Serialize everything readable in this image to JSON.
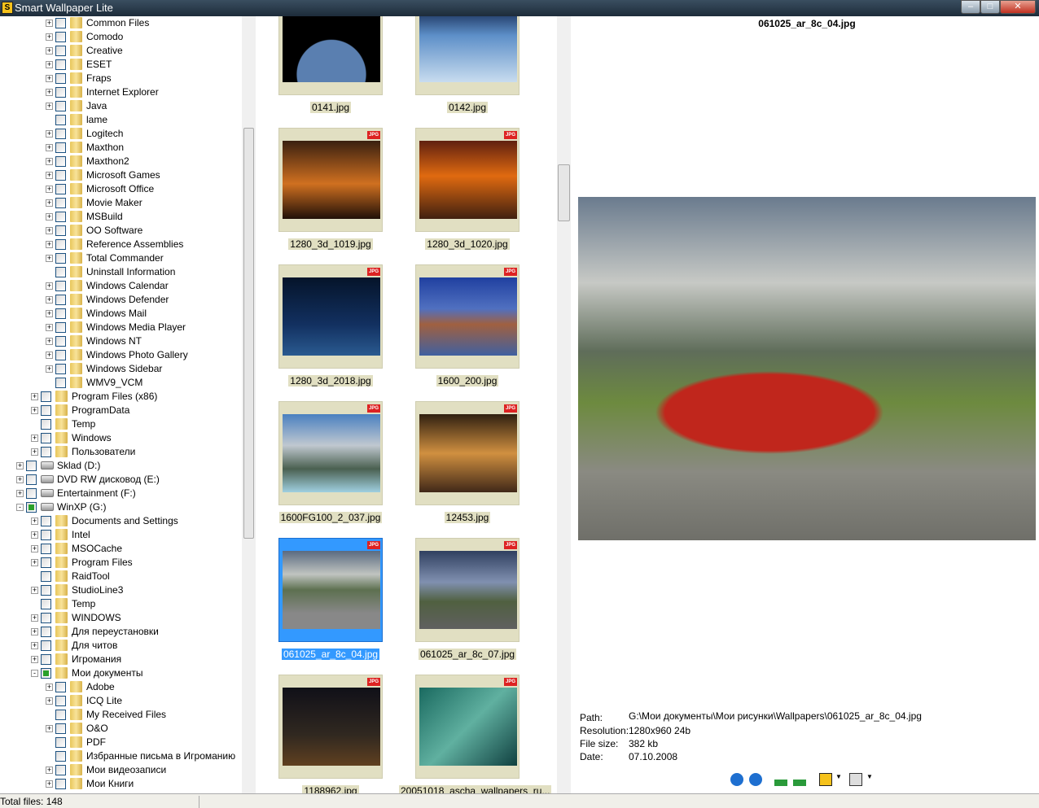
{
  "window": {
    "title": "Smart Wallpaper Lite",
    "minimize": "–",
    "maximize": "□",
    "close": "✕"
  },
  "tree": [
    {
      "l": 3,
      "e": "+",
      "t": "Common Files"
    },
    {
      "l": 3,
      "e": "+",
      "t": "Comodo"
    },
    {
      "l": 3,
      "e": "+",
      "t": "Creative"
    },
    {
      "l": 3,
      "e": "+",
      "t": "ESET"
    },
    {
      "l": 3,
      "e": "+",
      "t": "Fraps"
    },
    {
      "l": 3,
      "e": "+",
      "t": "Internet Explorer"
    },
    {
      "l": 3,
      "e": "+",
      "t": "Java"
    },
    {
      "l": 3,
      "e": "",
      "t": "lame"
    },
    {
      "l": 3,
      "e": "+",
      "t": "Logitech"
    },
    {
      "l": 3,
      "e": "+",
      "t": "Maxthon"
    },
    {
      "l": 3,
      "e": "+",
      "t": "Maxthon2"
    },
    {
      "l": 3,
      "e": "+",
      "t": "Microsoft Games"
    },
    {
      "l": 3,
      "e": "+",
      "t": "Microsoft Office"
    },
    {
      "l": 3,
      "e": "+",
      "t": "Movie Maker"
    },
    {
      "l": 3,
      "e": "+",
      "t": "MSBuild"
    },
    {
      "l": 3,
      "e": "+",
      "t": "OO Software"
    },
    {
      "l": 3,
      "e": "+",
      "t": "Reference Assemblies"
    },
    {
      "l": 3,
      "e": "+",
      "t": "Total Commander"
    },
    {
      "l": 3,
      "e": "",
      "t": "Uninstall Information"
    },
    {
      "l": 3,
      "e": "+",
      "t": "Windows Calendar"
    },
    {
      "l": 3,
      "e": "+",
      "t": "Windows Defender"
    },
    {
      "l": 3,
      "e": "+",
      "t": "Windows Mail"
    },
    {
      "l": 3,
      "e": "+",
      "t": "Windows Media Player"
    },
    {
      "l": 3,
      "e": "+",
      "t": "Windows NT"
    },
    {
      "l": 3,
      "e": "+",
      "t": "Windows Photo Gallery"
    },
    {
      "l": 3,
      "e": "+",
      "t": "Windows Sidebar"
    },
    {
      "l": 3,
      "e": "",
      "t": "WMV9_VCM"
    },
    {
      "l": 2,
      "e": "+",
      "t": "Program Files (x86)"
    },
    {
      "l": 2,
      "e": "+",
      "t": "ProgramData"
    },
    {
      "l": 2,
      "e": "",
      "t": "Temp"
    },
    {
      "l": 2,
      "e": "+",
      "t": "Windows"
    },
    {
      "l": 2,
      "e": "+",
      "t": "Пользователи"
    },
    {
      "l": 1,
      "e": "+",
      "t": "Sklad (D:)",
      "drive": true
    },
    {
      "l": 1,
      "e": "+",
      "t": "DVD RW дисковод (E:)",
      "drive": true
    },
    {
      "l": 1,
      "e": "+",
      "t": "Entertainment (F:)",
      "drive": true
    },
    {
      "l": 1,
      "e": "-",
      "t": "WinXP (G:)",
      "drive": true,
      "checked": true
    },
    {
      "l": 2,
      "e": "+",
      "t": "Documents and Settings"
    },
    {
      "l": 2,
      "e": "+",
      "t": "Intel"
    },
    {
      "l": 2,
      "e": "+",
      "t": "MSOCache"
    },
    {
      "l": 2,
      "e": "+",
      "t": "Program Files"
    },
    {
      "l": 2,
      "e": "",
      "t": "RaidTool"
    },
    {
      "l": 2,
      "e": "+",
      "t": "StudioLine3"
    },
    {
      "l": 2,
      "e": "",
      "t": "Temp"
    },
    {
      "l": 2,
      "e": "+",
      "t": "WINDOWS"
    },
    {
      "l": 2,
      "e": "+",
      "t": "Для переустановки"
    },
    {
      "l": 2,
      "e": "+",
      "t": "Для читов"
    },
    {
      "l": 2,
      "e": "+",
      "t": "Игромания"
    },
    {
      "l": 2,
      "e": "-",
      "t": "Мои документы",
      "checked": true
    },
    {
      "l": 3,
      "e": "+",
      "t": "Adobe"
    },
    {
      "l": 3,
      "e": "+",
      "t": "ICQ Lite"
    },
    {
      "l": 3,
      "e": "",
      "t": "My Received Files"
    },
    {
      "l": 3,
      "e": "+",
      "t": "O&O"
    },
    {
      "l": 3,
      "e": "",
      "t": "PDF"
    },
    {
      "l": 3,
      "e": "",
      "t": "Избранные письма в Игроманию"
    },
    {
      "l": 3,
      "e": "+",
      "t": "Мои видеозаписи"
    },
    {
      "l": 3,
      "e": "+",
      "t": "Мои Книги"
    }
  ],
  "thumbnails": [
    {
      "name": "0141.jpg",
      "badge": "",
      "bg": "radial-gradient(circle at 50% 90%,#5a7fb0 0 40%,#000 41%)"
    },
    {
      "name": "0142.jpg",
      "badge": "",
      "bg": "linear-gradient(#0a1a40,#5d8fc8 40%,#c8dcef)"
    },
    {
      "name": "1280_3d_1019.jpg",
      "badge": "JPG",
      "bg": "linear-gradient(#3a2010,#d07020 55%,#201008)"
    },
    {
      "name": "1280_3d_1020.jpg",
      "badge": "JPG",
      "bg": "linear-gradient(#602010,#e06a10 45%,#402010)"
    },
    {
      "name": "1280_3d_2018.jpg",
      "badge": "JPG",
      "bg": "linear-gradient(#05142a,#123060 60%,#2a5a90)"
    },
    {
      "name": "1600_200.jpg",
      "badge": "JPG",
      "bg": "linear-gradient(#2040a0,#5070c0 40%,#a06040 60%,#4060a0)"
    },
    {
      "name": "1600FG100_2_037.jpg",
      "badge": "JPG",
      "bg": "linear-gradient(#4a80c0,#c0c8d0 40%,#4a6050 70%,#a0d0e0)"
    },
    {
      "name": "12453.jpg",
      "badge": "JPG",
      "bg": "linear-gradient(#302010,#d09040 50%,#402818)"
    },
    {
      "name": "061025_ar_8c_04.jpg",
      "badge": "JPG",
      "bg": "linear-gradient(#5a6a80,#c0c4c0 30%,#5d7050 50%,#888 80%)",
      "selected": true
    },
    {
      "name": "061025_ar_8c_07.jpg",
      "badge": "JPG",
      "bg": "linear-gradient(#304060,#8090b0 40%,#506040 65%,#606060)"
    },
    {
      "name": "1188962.jpg",
      "badge": "JPG",
      "bg": "linear-gradient(#101018,#302820 60%,#604020)"
    },
    {
      "name": "20051018_ascha_wallpapers_ru...",
      "badge": "JPG",
      "bg": "linear-gradient(135deg,#1a6a60,#60b0a0 50%,#104040)"
    }
  ],
  "preview": {
    "filename": "061025_ar_8c_04.jpg"
  },
  "info": {
    "path_label": "Path:",
    "path": "G:\\Мои документы\\Мои рисунки\\Wallpapers\\061025_ar_8c_04.jpg",
    "resolution_label": "Resolution:",
    "resolution": "1280x960 24b",
    "size_label": "File size:",
    "size": "382 kb",
    "date_label": "Date:",
    "date": "07.10.2008"
  },
  "status": {
    "total": "Total files: 148"
  },
  "colors": {
    "selection": "#3399ff",
    "thumb_bg": "#e1dfc2"
  }
}
